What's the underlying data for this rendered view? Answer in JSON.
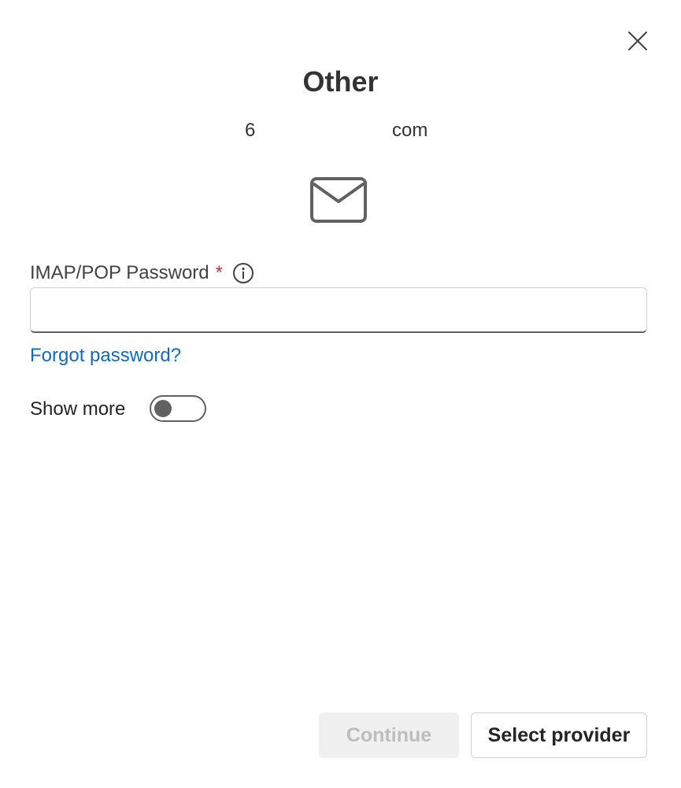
{
  "dialog": {
    "title": "Other",
    "email": {
      "visible_start": "6",
      "visible_end": "com"
    },
    "close_icon": "close-icon",
    "mail_icon": "envelope-icon"
  },
  "password_field": {
    "label": "IMAP/POP Password",
    "required_marker": "*",
    "info_icon": "info-icon",
    "value": "",
    "placeholder": ""
  },
  "forgot_password": {
    "label": "Forgot password?"
  },
  "show_more": {
    "label": "Show more",
    "toggle_on": false
  },
  "buttons": {
    "continue_label": "Continue",
    "continue_enabled": false,
    "select_provider_label": "Select provider"
  },
  "colors": {
    "link": "#0f6cbd",
    "required": "#c4314b",
    "disabled_bg": "#f0f0f0",
    "disabled_text": "#bdbdbd"
  }
}
